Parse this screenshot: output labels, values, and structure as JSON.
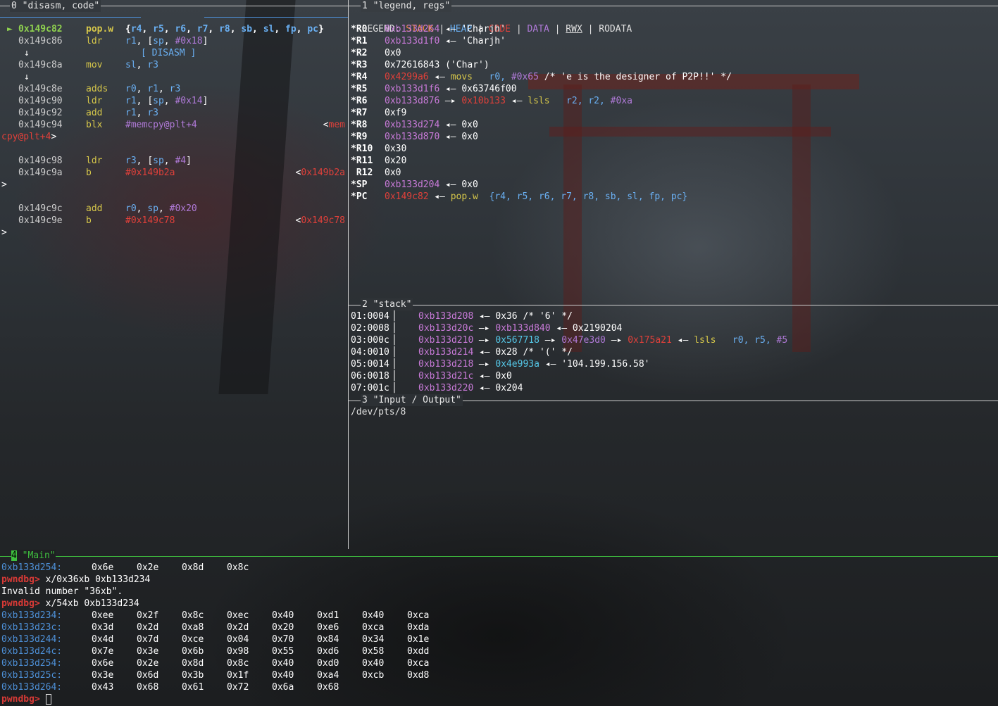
{
  "panes": {
    "disasm": {
      "title": "0 \"disasm, code\"",
      "header": "[ DISASM ]"
    },
    "regs": {
      "title": "1 \"legend, regs\""
    },
    "stack": {
      "title": "2 \"stack\""
    },
    "io": {
      "title": "3 \"Input / Output\"",
      "tty": "/dev/pts/8"
    },
    "main": {
      "num": "4",
      "title": " \"Main\""
    }
  },
  "legend": {
    "label": "LEGEND:",
    "items": [
      "STACK",
      "HEAP",
      "CODE",
      "DATA",
      "RWX",
      "RODATA"
    ],
    "sep": " | "
  },
  "disasm": {
    "current_marker": "►",
    "rows": [
      {
        "addr": "0x149c82",
        "mnem": "pop.w",
        "ops": "{r4, r5, r6, r7, r8, sb, sl, fp, pc}",
        "current": true
      },
      {
        "addr": "0x149c86",
        "mnem": "ldr",
        "ops": "r1, [sp, #0x18]"
      },
      {
        "arrow": "↓"
      },
      {
        "addr": "0x149c8a",
        "mnem": "mov",
        "ops": "sl, r3"
      },
      {
        "arrow": "↓"
      },
      {
        "addr": "0x149c8e",
        "mnem": "adds",
        "ops": "r0, r1, r3"
      },
      {
        "addr": "0x149c90",
        "mnem": "ldr",
        "ops": "r1, [sp, #0x14]"
      },
      {
        "addr": "0x149c92",
        "mnem": "add",
        "ops": "r1, r3"
      },
      {
        "addr": "0x149c94",
        "mnem": "blx",
        "ops": "#memcpy@plt+4",
        "target": "<mem",
        "wrap": "cpy@plt+4>"
      },
      {
        "addr": "0x149c98",
        "mnem": "ldr",
        "ops": "r3, [sp, #4]"
      },
      {
        "addr": "0x149c9a",
        "mnem": "b",
        "ops": "#0x149b2a",
        "target": "<0x149b2a",
        "wrap": ">"
      },
      {
        "addr": "0x149c9c",
        "mnem": "add",
        "ops": "r0, sp, #0x20"
      },
      {
        "addr": "0x149c9e",
        "mnem": "b",
        "ops": "#0x149c78",
        "target": "<0x149c78",
        "wrap": ">"
      }
    ]
  },
  "regs": [
    {
      "name": "*R0",
      "val": "0xb133d264",
      "rest": " ◂— 'Charjh'"
    },
    {
      "name": "*R1",
      "val": "0xb133d1f0",
      "rest": " ◂— 'Charjh'"
    },
    {
      "name": "*R2",
      "plain": "0x0"
    },
    {
      "name": "*R3",
      "plain": "0x72616843 ('Char')"
    },
    {
      "name": "*R4",
      "val": "0x4299a6",
      "rest": " ◂— movs   r0, #0x65 /* 'e is the designer of P2P!!' */"
    },
    {
      "name": "*R5",
      "val": "0xb133d1f6",
      "rest": " ◂— 0x63746f00"
    },
    {
      "name": "*R6",
      "val": "0xb133d876",
      "rest": " —▸ 0x10b133 ◂— lsls   r2, r2, #0xa"
    },
    {
      "name": "*R7",
      "plain": "0xf9"
    },
    {
      "name": "*R8",
      "val": "0xb133d274",
      "rest": " ◂— 0x0"
    },
    {
      "name": "*R9",
      "val": "0xb133d870",
      "rest": " ◂— 0x0"
    },
    {
      "name": "*R10",
      "plain": "0x30"
    },
    {
      "name": "*R11",
      "plain": "0x20"
    },
    {
      "name": " R12",
      "plain": "0x0"
    },
    {
      "name": "*SP",
      "val": "0xb133d204",
      "rest": " ◂— 0x0"
    },
    {
      "name": "*PC",
      "val": "0x149c82",
      "rest": " ◂— pop.w  {r4, r5, r6, r7, r8, sb, sl, fp, pc}"
    }
  ],
  "stack": [
    {
      "idx": "01:0004",
      "addr": "0xb133d208",
      "rest": " ◂— 0x36 /* '6' */"
    },
    {
      "idx": "02:0008",
      "addr": "0xb133d20c",
      "rest": " —▸ 0xb133d840 ◂— 0x2190204"
    },
    {
      "idx": "03:000c",
      "addr": "0xb133d210",
      "rest": " —▸ 0x567718 —▸ 0x47e3d0 —▸ 0x175a21 ◂— lsls   r0, r5, #5"
    },
    {
      "idx": "04:0010",
      "addr": "0xb133d214",
      "rest": " ◂— 0x28 /* '(' */"
    },
    {
      "idx": "05:0014",
      "addr": "0xb133d218",
      "rest": " —▸ 0x4e993a ◂— '104.199.156.58'"
    },
    {
      "idx": "06:0018",
      "addr": "0xb133d21c",
      "rest": " ◂— 0x0"
    },
    {
      "idx": "07:001c",
      "addr": "0xb133d220",
      "rest": " ◂— 0x204"
    }
  ],
  "main": {
    "prompt": "pwndbg>",
    "first_row": {
      "addr": "0xb133d254:",
      "bytes": [
        "0x6e",
        "0x2e",
        "0x8d",
        "0x8c"
      ]
    },
    "cmd1": "x/0x36xb 0xb133d234",
    "err": "Invalid number \"36xb\".",
    "cmd2": "x/54xb 0xb133d234",
    "dump": [
      {
        "addr": "0xb133d234:",
        "bytes": [
          "0xee",
          "0x2f",
          "0x8c",
          "0xec",
          "0x40",
          "0xd1",
          "0x40",
          "0xca"
        ]
      },
      {
        "addr": "0xb133d23c:",
        "bytes": [
          "0x3d",
          "0x2d",
          "0xa8",
          "0x2d",
          "0x20",
          "0xe6",
          "0xca",
          "0xda"
        ]
      },
      {
        "addr": "0xb133d244:",
        "bytes": [
          "0x4d",
          "0x7d",
          "0xce",
          "0x04",
          "0x70",
          "0x84",
          "0x34",
          "0x1e"
        ]
      },
      {
        "addr": "0xb133d24c:",
        "bytes": [
          "0x7e",
          "0x3e",
          "0x6b",
          "0x98",
          "0x55",
          "0xd6",
          "0x58",
          "0xdd"
        ]
      },
      {
        "addr": "0xb133d254:",
        "bytes": [
          "0x6e",
          "0x2e",
          "0x8d",
          "0x8c",
          "0x40",
          "0xd0",
          "0x40",
          "0xca"
        ]
      },
      {
        "addr": "0xb133d25c:",
        "bytes": [
          "0x3e",
          "0x6d",
          "0x3b",
          "0x1f",
          "0x40",
          "0xa4",
          "0xcb",
          "0xd8"
        ]
      },
      {
        "addr": "0xb133d264:",
        "bytes": [
          "0x43",
          "0x68",
          "0x61",
          "0x72",
          "0x6a",
          "0x68"
        ]
      }
    ]
  }
}
